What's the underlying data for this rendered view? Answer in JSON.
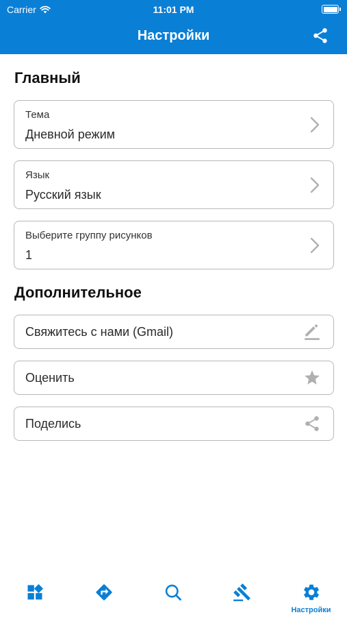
{
  "status_bar": {
    "carrier": "Carrier",
    "time": "11:01 PM"
  },
  "header": {
    "title": "Настройки"
  },
  "sections": {
    "main": {
      "title": "Главный",
      "items": [
        {
          "label": "Тема",
          "value": "Дневной режим"
        },
        {
          "label": "Язык",
          "value": "Русский язык"
        },
        {
          "label": "Выберите группу рисунков",
          "value": "1"
        }
      ]
    },
    "extra": {
      "title": "Дополнительное",
      "items": [
        {
          "label": "Свяжитесь с нами (Gmail)",
          "icon": "pencil-icon"
        },
        {
          "label": "Оценить",
          "icon": "star-icon"
        },
        {
          "label": "Поделись",
          "icon": "share-icon"
        }
      ]
    }
  },
  "tabbar": {
    "tabs": [
      {
        "icon": "widgets-icon"
      },
      {
        "icon": "directions-icon"
      },
      {
        "icon": "search-icon"
      },
      {
        "icon": "gavel-icon"
      },
      {
        "icon": "gear-icon",
        "label": "Настройки",
        "active": true
      }
    ]
  },
  "colors": {
    "accent": "#0a7fd6",
    "card_border": "#b8b8b8",
    "icon_gray": "#b0b0b0"
  }
}
